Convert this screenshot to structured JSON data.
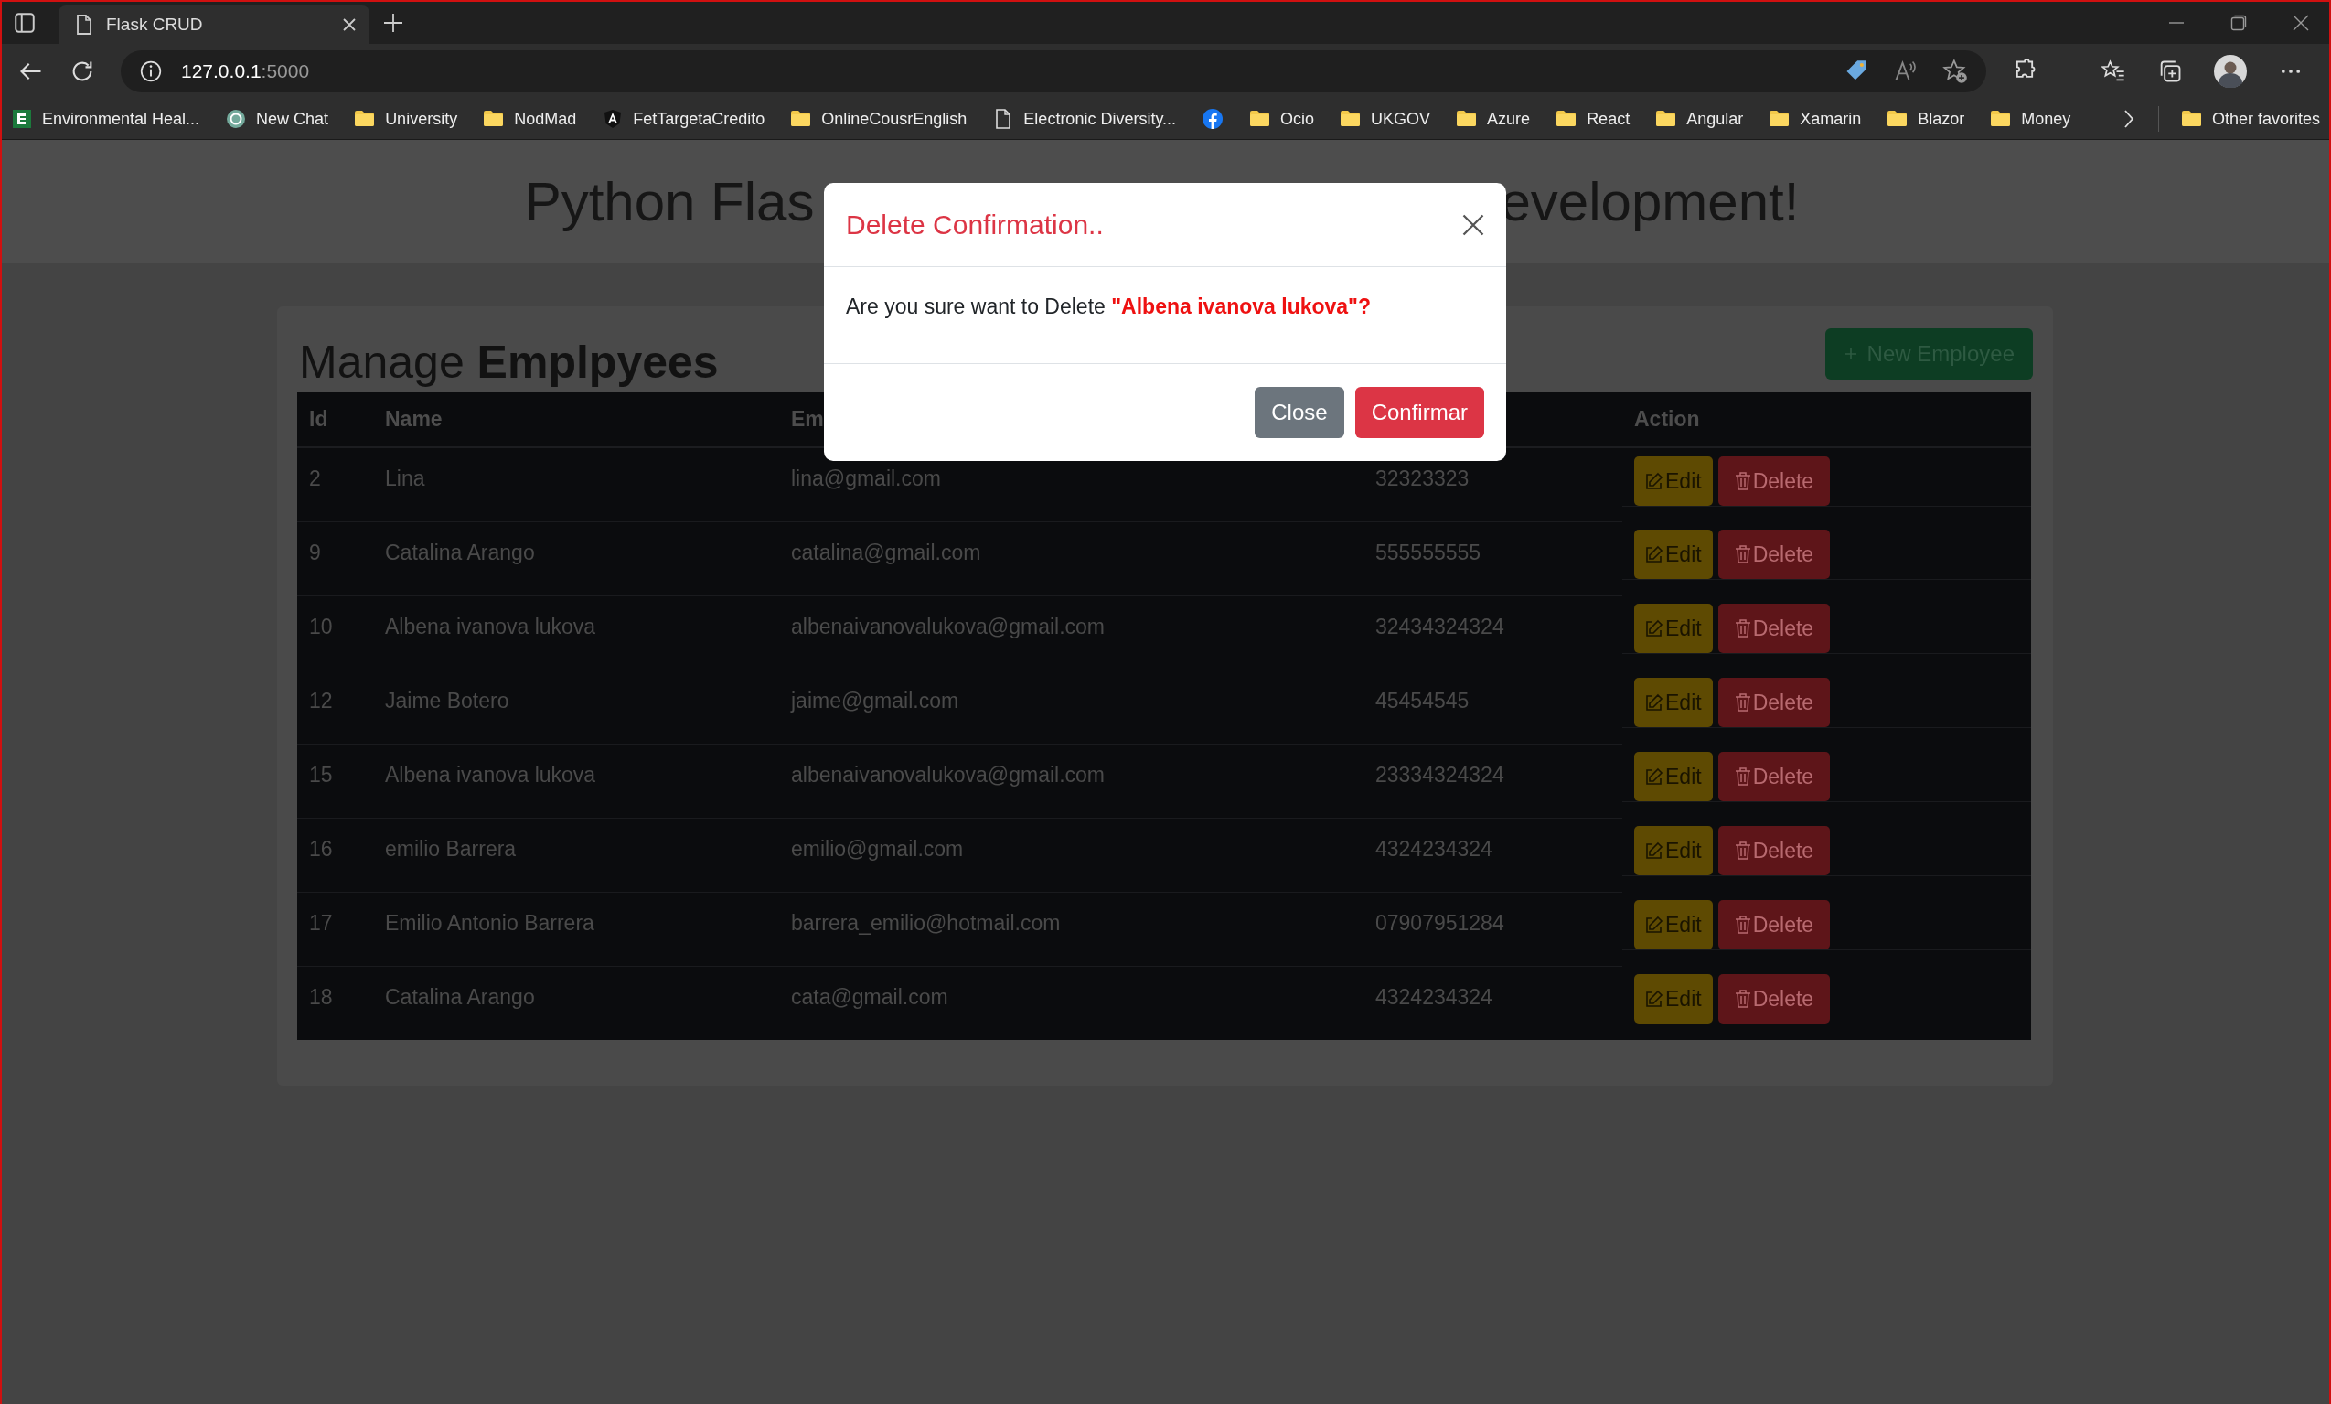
{
  "browser": {
    "tab": {
      "title": "Flask CRUD",
      "selected": true
    },
    "address": {
      "host": "127.0.0.1",
      "port": ":5000"
    },
    "bookmarks": [
      {
        "label": "Environmental Heal...",
        "kind": "site"
      },
      {
        "label": "New Chat",
        "kind": "chat"
      },
      {
        "label": "University",
        "kind": "folder"
      },
      {
        "label": "NodMad",
        "kind": "folder"
      },
      {
        "label": "FetTargetaCredito",
        "kind": "angular"
      },
      {
        "label": "OnlineCousrEnglish",
        "kind": "folder"
      },
      {
        "label": "Electronic Diversity...",
        "kind": "page"
      },
      {
        "kind": "facebook"
      },
      {
        "label": "Ocio",
        "kind": "folder"
      },
      {
        "label": "UKGOV",
        "kind": "folder"
      },
      {
        "label": "Azure",
        "kind": "folder"
      },
      {
        "label": "React",
        "kind": "folder"
      },
      {
        "label": "Angular",
        "kind": "folder"
      },
      {
        "label": "Xamarin",
        "kind": "folder"
      },
      {
        "label": "Blazor",
        "kind": "folder"
      },
      {
        "label": "Money",
        "kind": "folder"
      }
    ],
    "other_favorites": "Other favorites"
  },
  "page": {
    "title_parts": [
      "Python Flas",
      "evelopment!"
    ],
    "heading": "Manage **Emplpyees**",
    "new_button": "New Employee",
    "table": {
      "columns": [
        {
          "label": "Id"
        },
        {
          "label": "Name"
        },
        {
          "label": "Em"
        },
        {},
        {
          "label": "Action"
        }
      ],
      "rows": [
        {
          "id": "2",
          "name": "Lina",
          "email": "lina@gmail.com",
          "phone": "32323323",
          "edit": "Edit",
          "delete": "Delete"
        },
        {
          "id": "9",
          "name": "Catalina Arango",
          "email": "catalina@gmail.com",
          "phone": "555555555",
          "edit": "Edit",
          "delete": "Delete"
        },
        {
          "id": "10",
          "name": "Albena ivanova lukova",
          "email": "albenaivanovalukova@gmail.com",
          "phone": "32434324324",
          "edit": "Edit",
          "delete": "Delete"
        },
        {
          "id": "12",
          "name": "Jaime Botero",
          "email": "jaime@gmail.com",
          "phone": "45454545",
          "edit": "Edit",
          "delete": "Delete"
        },
        {
          "id": "15",
          "name": "Albena ivanova lukova",
          "email": "albenaivanovalukova@gmail.com",
          "phone": "23334324324",
          "edit": "Edit",
          "delete": "Delete"
        },
        {
          "id": "16",
          "name": "emilio Barrera",
          "email": "emilio@gmail.com",
          "phone": "4324234324",
          "edit": "Edit",
          "delete": "Delete"
        },
        {
          "id": "17",
          "name": "Emilio Antonio Barrera",
          "email": "barrera_emilio@hotmail.com",
          "phone": "07907951284",
          "edit": "Edit",
          "delete": "Delete"
        },
        {
          "id": "18",
          "name": "Catalina Arango",
          "email": "cata@gmail.com",
          "phone": "4324234324",
          "edit": "Edit",
          "delete": "Delete"
        }
      ]
    }
  },
  "modal": {
    "title": "Delete Confirmation..",
    "message": "Are you sure want to Delete **\"Albena ivanova lukova\"?**",
    "buttons": [
      {
        "label": "Close",
        "kind": "secondary"
      },
      {
        "label": "Confirmar",
        "kind": "danger"
      }
    ]
  }
}
